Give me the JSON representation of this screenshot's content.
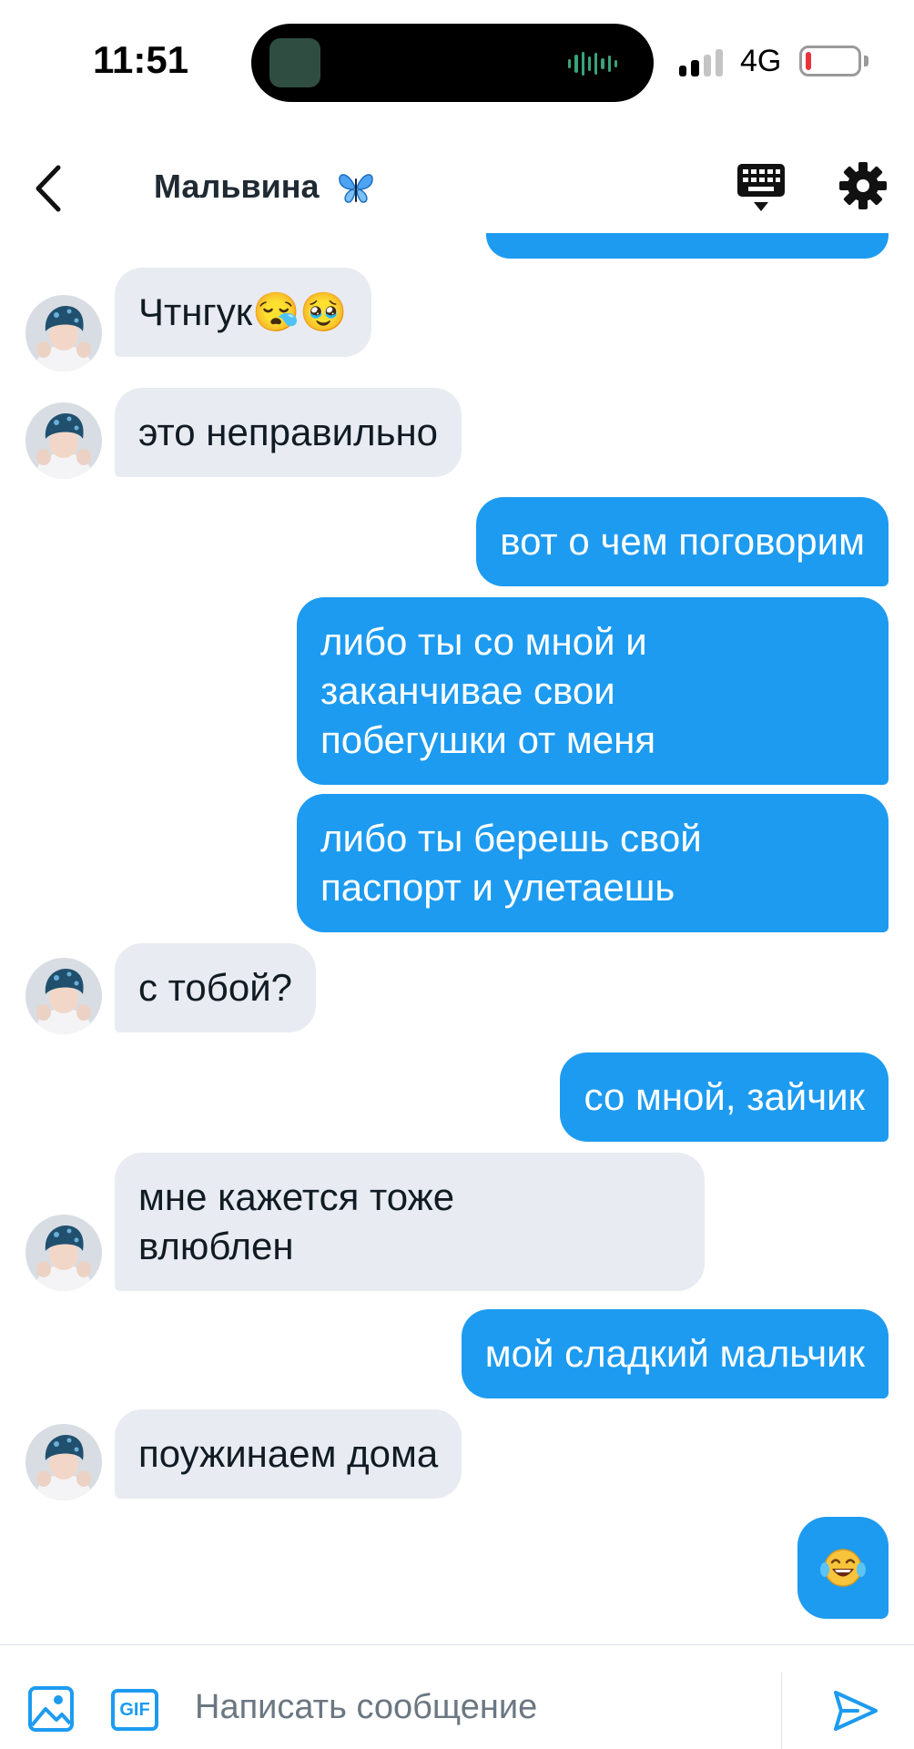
{
  "status_bar": {
    "time": "11:51",
    "network": "4G",
    "battery_level": 0.05
  },
  "header": {
    "title": "Мальвина",
    "back_icon": "chevron-left-icon",
    "keyboard_icon": "keyboard-icon",
    "settings_icon": "gear-icon"
  },
  "messages": [
    {
      "side": "in",
      "text": "Чтнгук😪🥹",
      "avatar": true
    },
    {
      "side": "in",
      "text": "это неправильно",
      "avatar": true
    },
    {
      "side": "out",
      "text": "вот о чем поговорим"
    },
    {
      "side": "out",
      "text": "либо ты со мной и\nзаканчивае свои\nпобегушки от меня"
    },
    {
      "side": "out",
      "text": "либо ты берешь свой\nпаспорт и улетаешь"
    },
    {
      "side": "in",
      "text": "с тобой?",
      "avatar": true
    },
    {
      "side": "out",
      "text": "со мной, зайчик"
    },
    {
      "side": "in",
      "text": "мне кажется тоже\nвлюблен",
      "avatar": true
    },
    {
      "side": "out",
      "text": "мой сладкий мальчик"
    },
    {
      "side": "in",
      "text": "поужинаем дома",
      "avatar": true
    },
    {
      "side": "out",
      "text": "😂",
      "emoji_only": true
    }
  ],
  "composer": {
    "placeholder": "Написать сообщение",
    "gif_label": "GIF",
    "image_icon": "image-icon",
    "send_icon": "send-icon"
  },
  "colors": {
    "outgoing_bubble": "#1d9bf0",
    "incoming_bubble": "#e8ebf1",
    "accent": "#1d9bf0"
  }
}
